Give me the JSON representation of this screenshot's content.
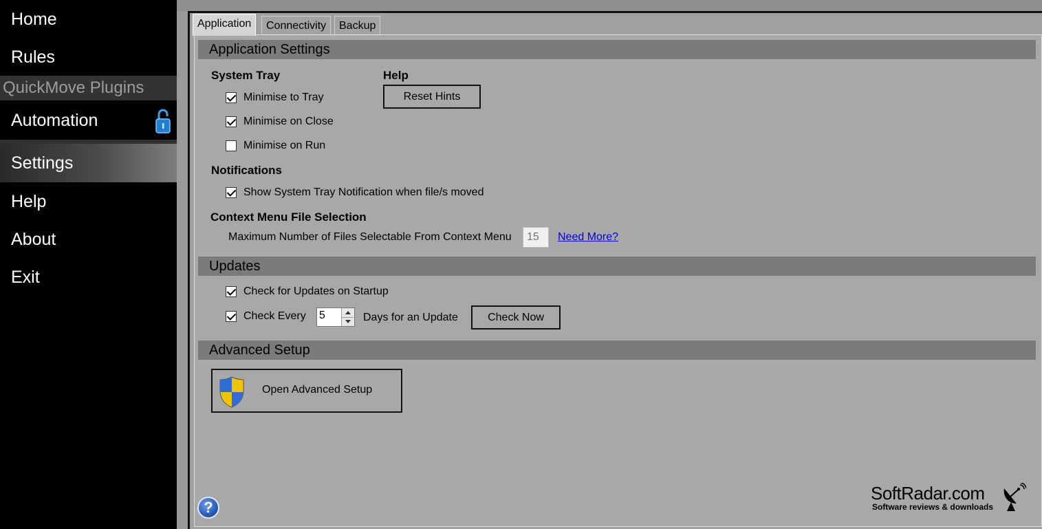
{
  "sidebar": {
    "home": "Home",
    "rules": "Rules",
    "section": "QuickMove Plugins",
    "automation": "Automation",
    "settings": "Settings",
    "help": "Help",
    "about": "About",
    "exit": "Exit"
  },
  "tabs": [
    "Application",
    "Connectivity",
    "Backup"
  ],
  "application_settings": {
    "header": "Application Settings",
    "system_tray": {
      "label": "System Tray",
      "minimise_to_tray": {
        "label": "Minimise to Tray",
        "checked": true
      },
      "minimise_on_close": {
        "label": "Minimise on Close",
        "checked": true
      },
      "minimise_on_run": {
        "label": "Minimise on Run",
        "checked": false
      }
    },
    "help": {
      "label": "Help",
      "reset_hints": "Reset Hints"
    },
    "notifications": {
      "label": "Notifications",
      "show_tray_notification": {
        "label": "Show System Tray Notification when file/s moved",
        "checked": true
      }
    },
    "context_menu": {
      "label": "Context Menu File Selection",
      "max_files_label": "Maximum Number of Files Selectable From Context Menu",
      "max_files_value": "15",
      "need_more": "Need More?"
    }
  },
  "updates": {
    "header": "Updates",
    "check_on_startup": {
      "label": "Check for Updates on Startup",
      "checked": true
    },
    "check_every": {
      "label": "Check Every",
      "checked": true,
      "days": "5",
      "suffix": "Days for an Update"
    },
    "check_now": "Check Now"
  },
  "advanced": {
    "header": "Advanced Setup",
    "open_button": "Open Advanced Setup"
  },
  "help_button": "?",
  "watermark": {
    "title": "SoftRadar.com",
    "subtitle": "Software reviews & downloads"
  }
}
